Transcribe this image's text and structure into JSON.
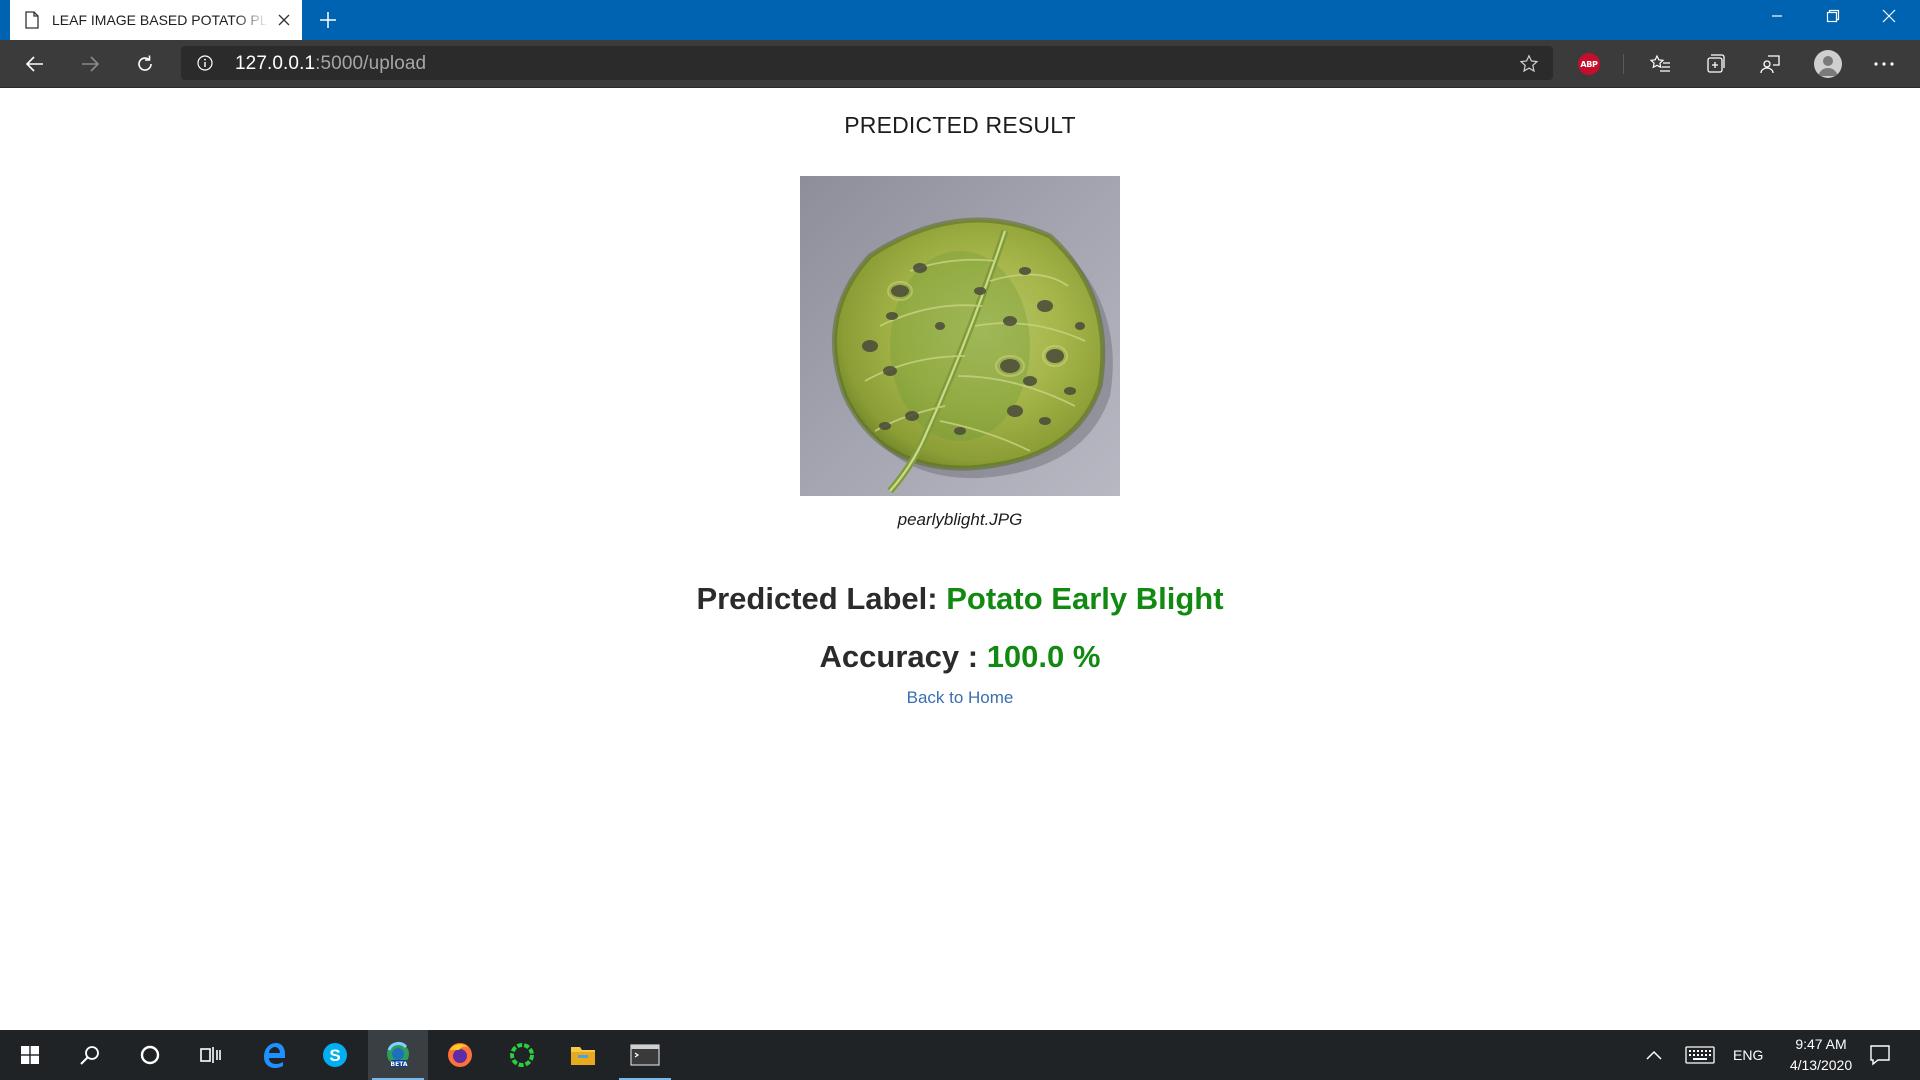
{
  "browser": {
    "tab_title": "LEAF IMAGE BASED POTATO PLA",
    "url_host": "127.0.0.1",
    "url_rest": ":5000/upload",
    "abp_label": "ABP"
  },
  "page": {
    "heading": "PREDICTED RESULT",
    "image_caption": "pearlyblight.JPG",
    "predicted_label_prefix": "Predicted Label: ",
    "predicted_label_value": "Potato Early Blight",
    "accuracy_prefix": "Accuracy : ",
    "accuracy_value": "100.0 %",
    "back_link": "Back to Home",
    "accent_color": "#128a12",
    "link_color": "#3a6fb0"
  },
  "taskbar": {
    "items": [
      "start",
      "search",
      "cortana",
      "task-view",
      "edge-legacy",
      "skype",
      "edge-beta",
      "firefox",
      "spinner-app",
      "file-explorer",
      "terminal"
    ],
    "language": "ENG",
    "time": "9:47 AM",
    "date": "4/13/2020"
  },
  "colors": {
    "titlebar": "#0063b1",
    "navbar": "#3b3b3b",
    "taskbar": "#1f2326"
  }
}
